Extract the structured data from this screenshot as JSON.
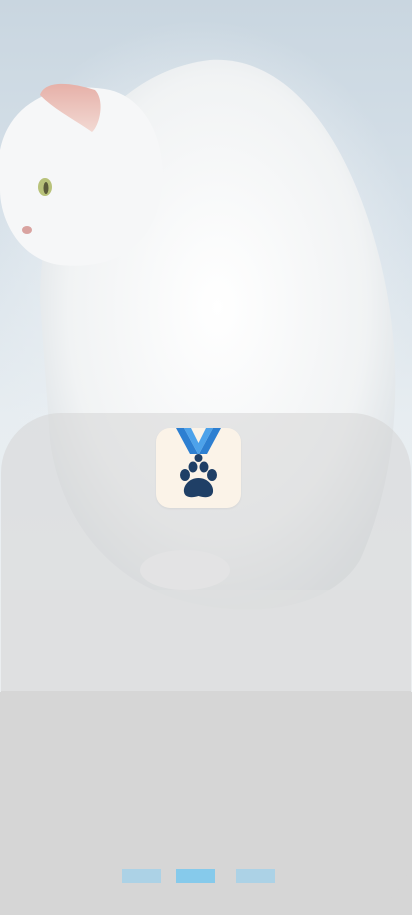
{
  "hero": {
    "icon": "cat-photo"
  },
  "app_icon": {
    "icon": "paw-medal-icon",
    "colors": {
      "ribbon": "#2d7fd1",
      "paw": "#1f3f66",
      "background": "#fbf3e8"
    }
  },
  "pager": {
    "total_pages": 3,
    "current_page": 2,
    "colors": {
      "active": "#86caeb",
      "inactive": "#acd2e6"
    }
  }
}
